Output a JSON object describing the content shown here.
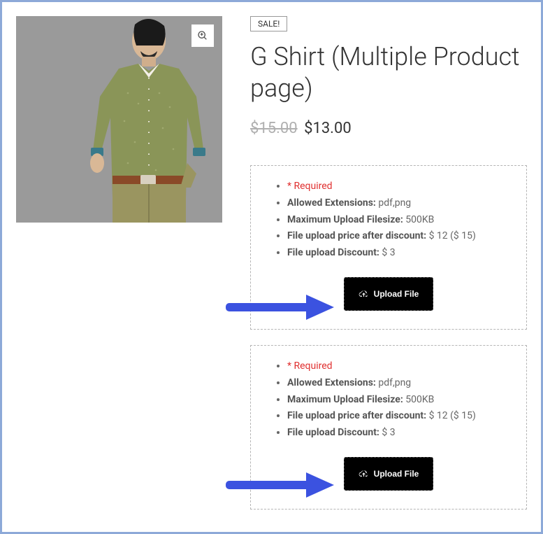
{
  "sale_badge": "SALE!",
  "product_title": "G Shirt (Multiple Product page)",
  "price": {
    "old": "$15.00",
    "current": "$13.00"
  },
  "upload_blocks": [
    {
      "required_label": "* Required",
      "ext_label": "Allowed Extensions:",
      "ext_value": " pdf,png",
      "max_label": "Maximum Upload Filesize:",
      "max_value": " 500KB",
      "price_after_label": "File upload price after discount:",
      "price_after_value": " $ 12 ($ 15)",
      "discount_label": "File upload Discount:",
      "discount_value": " $ 3",
      "button": "Upload File"
    },
    {
      "required_label": "* Required",
      "ext_label": "Allowed Extensions:",
      "ext_value": " pdf,png",
      "max_label": "Maximum Upload Filesize:",
      "max_value": " 500KB",
      "price_after_label": "File upload price after discount:",
      "price_after_value": " $ 12 ($ 15)",
      "discount_label": "File upload Discount:",
      "discount_value": " $ 3",
      "button": "Upload File"
    }
  ]
}
